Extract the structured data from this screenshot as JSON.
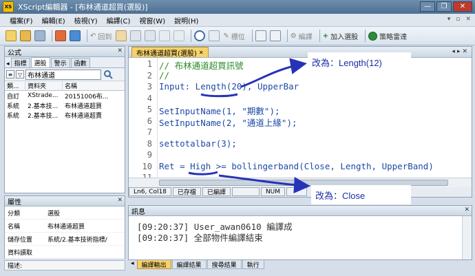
{
  "window": {
    "app_icon": "XS",
    "title": "XScript編輯器 - [布林通道超買(選股)]",
    "buttons": [
      "—",
      "❐",
      "✕"
    ]
  },
  "menu": {
    "items": [
      "檔案(F)",
      "編輯(E)",
      "檢視(Y)",
      "編譯(C)",
      "視窗(W)",
      "說明(H)"
    ],
    "right_icons": [
      "▾",
      "▫",
      "✕"
    ]
  },
  "toolbar": {
    "relocate": "回到",
    "mark": "標位",
    "compile": "編譯",
    "add_to_select": "加入選股",
    "strategy_radar": "策略雷達"
  },
  "formula_panel": {
    "title": "公式",
    "tabs": [
      "指標",
      "選股",
      "警示",
      "函數"
    ],
    "search_value": "布林通道",
    "columns": [
      "類...",
      "資料夾",
      "名稱"
    ],
    "rows": [
      [
        "自訂",
        "XStrade...",
        "20151006布..."
      ],
      [
        "系統",
        "2.基本技...",
        "布林通道超買"
      ],
      [
        "系統",
        "2.基本技...",
        "布林通道超賣"
      ]
    ]
  },
  "properties_panel": {
    "title": "屬性",
    "rows": [
      [
        "分類",
        "選股"
      ],
      [
        "名稱",
        "布林通道超買"
      ],
      [
        "儲存位置",
        "系統/2.基本技術指標/"
      ],
      [
        "資料讀取",
        ""
      ]
    ],
    "desc_label": "描述:"
  },
  "editor": {
    "tab_label": "布林通道超買(選股)",
    "line_numbers": [
      "1",
      "2",
      "3",
      "4",
      "5",
      "6",
      "7",
      "8",
      "9",
      "10",
      "11"
    ],
    "lines": [
      "// 布林通道超買訊號",
      "//",
      "Input: Length(20), UpperBar",
      "",
      "SetInputName(1, \"期數\");",
      "SetInputName(2, \"通道上緣\");",
      "",
      "settotalbar(3);",
      "",
      "Ret = High >= bollingerband(Close, Length, UpperBand)",
      ""
    ],
    "status": [
      "Ln6, Col18",
      "已存檔",
      "已編譯",
      "",
      "NUM",
      ""
    ]
  },
  "output_panel": {
    "title": "訊息",
    "lines": [
      "[09:20:37] User_awan0610 編譯成",
      "[09:20:37] 全部物件編譯結束"
    ],
    "tabs": [
      "編譯輸出",
      "編譯結果",
      "搜尋結果",
      "執行"
    ]
  },
  "annotations": {
    "callout_length": "改為：Length(12)",
    "callout_close": "改為：Close",
    "color": "#2633b8"
  }
}
